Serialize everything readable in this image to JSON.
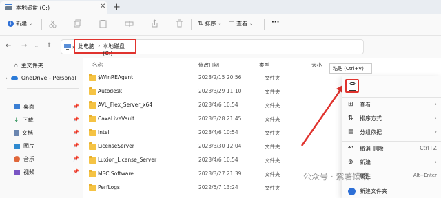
{
  "tab": {
    "title": "本地磁盘 (C:)",
    "close": "✕",
    "new": "+"
  },
  "toolbar": {
    "new_label": "新建",
    "sort_label": "排序",
    "view_label": "查看",
    "more": "···"
  },
  "nav": {
    "crumbs": [
      "此电脑",
      "本地磁盘 (C:)"
    ]
  },
  "sidebar": {
    "items": [
      {
        "label": "主文件夹",
        "icon": "home-icon"
      },
      {
        "label": "OneDrive - Personal",
        "icon": "cloud-icon"
      },
      {
        "label": "桌面",
        "icon": "desktop-icon"
      },
      {
        "label": "下载",
        "icon": "download-icon"
      },
      {
        "label": "文档",
        "icon": "document-icon"
      },
      {
        "label": "图片",
        "icon": "picture-icon"
      },
      {
        "label": "音乐",
        "icon": "music-icon"
      },
      {
        "label": "视频",
        "icon": "video-icon"
      }
    ],
    "pin": "📌"
  },
  "columns": {
    "name": "名称",
    "modified": "修改日期",
    "type": "类型",
    "size": "大小"
  },
  "files": [
    {
      "name": "$WinREAgent",
      "date": "2023/2/15 20:56",
      "type": "文件夹"
    },
    {
      "name": "Autodesk",
      "date": "2023/3/29 11:10",
      "type": "文件夹"
    },
    {
      "name": "AVL_Flex_Server_x64",
      "date": "2023/4/6 10:54",
      "type": "文件夹"
    },
    {
      "name": "CaxaLiveVault",
      "date": "2023/3/28 21:45",
      "type": "文件夹"
    },
    {
      "name": "Intel",
      "date": "2023/4/6 10:54",
      "type": "文件夹"
    },
    {
      "name": "LicenseServer",
      "date": "2023/3/30 12:04",
      "type": "文件夹"
    },
    {
      "name": "Luxion_License_Server",
      "date": "2023/4/6 10:54",
      "type": "文件夹"
    },
    {
      "name": "MSC.Software",
      "date": "2023/3/27 21:39",
      "type": "文件夹"
    },
    {
      "name": "PerfLogs",
      "date": "2022/5/7 13:24",
      "type": "文件夹"
    }
  ],
  "context_menu": {
    "tooltip": "粘贴 (Ctrl+V)",
    "items": [
      {
        "label": "查看",
        "has_sub": true
      },
      {
        "label": "排序方式",
        "has_sub": true
      },
      {
        "label": "分组依据",
        "has_sub": true
      },
      {
        "label": "撤消 删除",
        "shortcut": "Ctrl+Z"
      },
      {
        "label": "新建",
        "has_sub": true
      },
      {
        "label": "属性",
        "shortcut": "Alt+Enter"
      },
      {
        "label": "新建文件夹"
      }
    ]
  },
  "watermark": "公众号 · 紫薯馍馍",
  "colors": {
    "accent": "#0067c0",
    "highlight": "#e0332e",
    "folder": "#f5c344"
  }
}
